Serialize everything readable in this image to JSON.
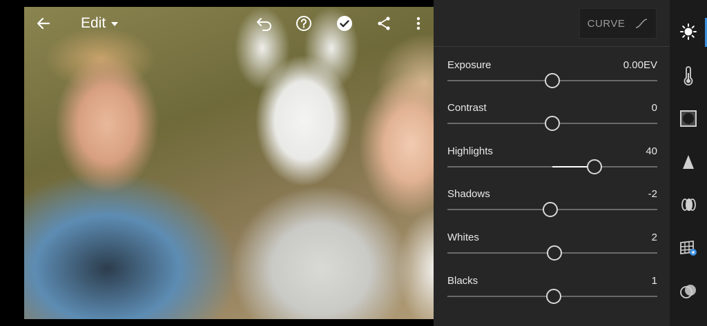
{
  "toolbar": {
    "edit_label": "Edit",
    "icons": [
      "back-arrow-icon",
      "undo-icon",
      "help-icon",
      "done-check-icon",
      "share-icon",
      "more-vert-icon"
    ]
  },
  "panel": {
    "curve_label": "CURVE",
    "sliders": [
      {
        "label": "Exposure",
        "value": "0.00EV",
        "position": 0.5
      },
      {
        "label": "Contrast",
        "value": "0",
        "position": 0.5
      },
      {
        "label": "Highlights",
        "value": "40",
        "position": 0.7
      },
      {
        "label": "Shadows",
        "value": "-2",
        "position": 0.49
      },
      {
        "label": "Whites",
        "value": "2",
        "position": 0.51
      },
      {
        "label": "Blacks",
        "value": "1",
        "position": 0.505
      }
    ]
  },
  "rail": {
    "items": [
      "light-icon",
      "color-temperature-icon",
      "effects-vignette-icon",
      "detail-sharpen-icon",
      "optics-lens-icon",
      "geometry-grid-icon",
      "presets-blend-icon"
    ],
    "active": "light-icon"
  },
  "colors": {
    "accent": "#3a8fe0",
    "panel_bg": "#262626",
    "rail_bg": "#1b1b1b"
  }
}
